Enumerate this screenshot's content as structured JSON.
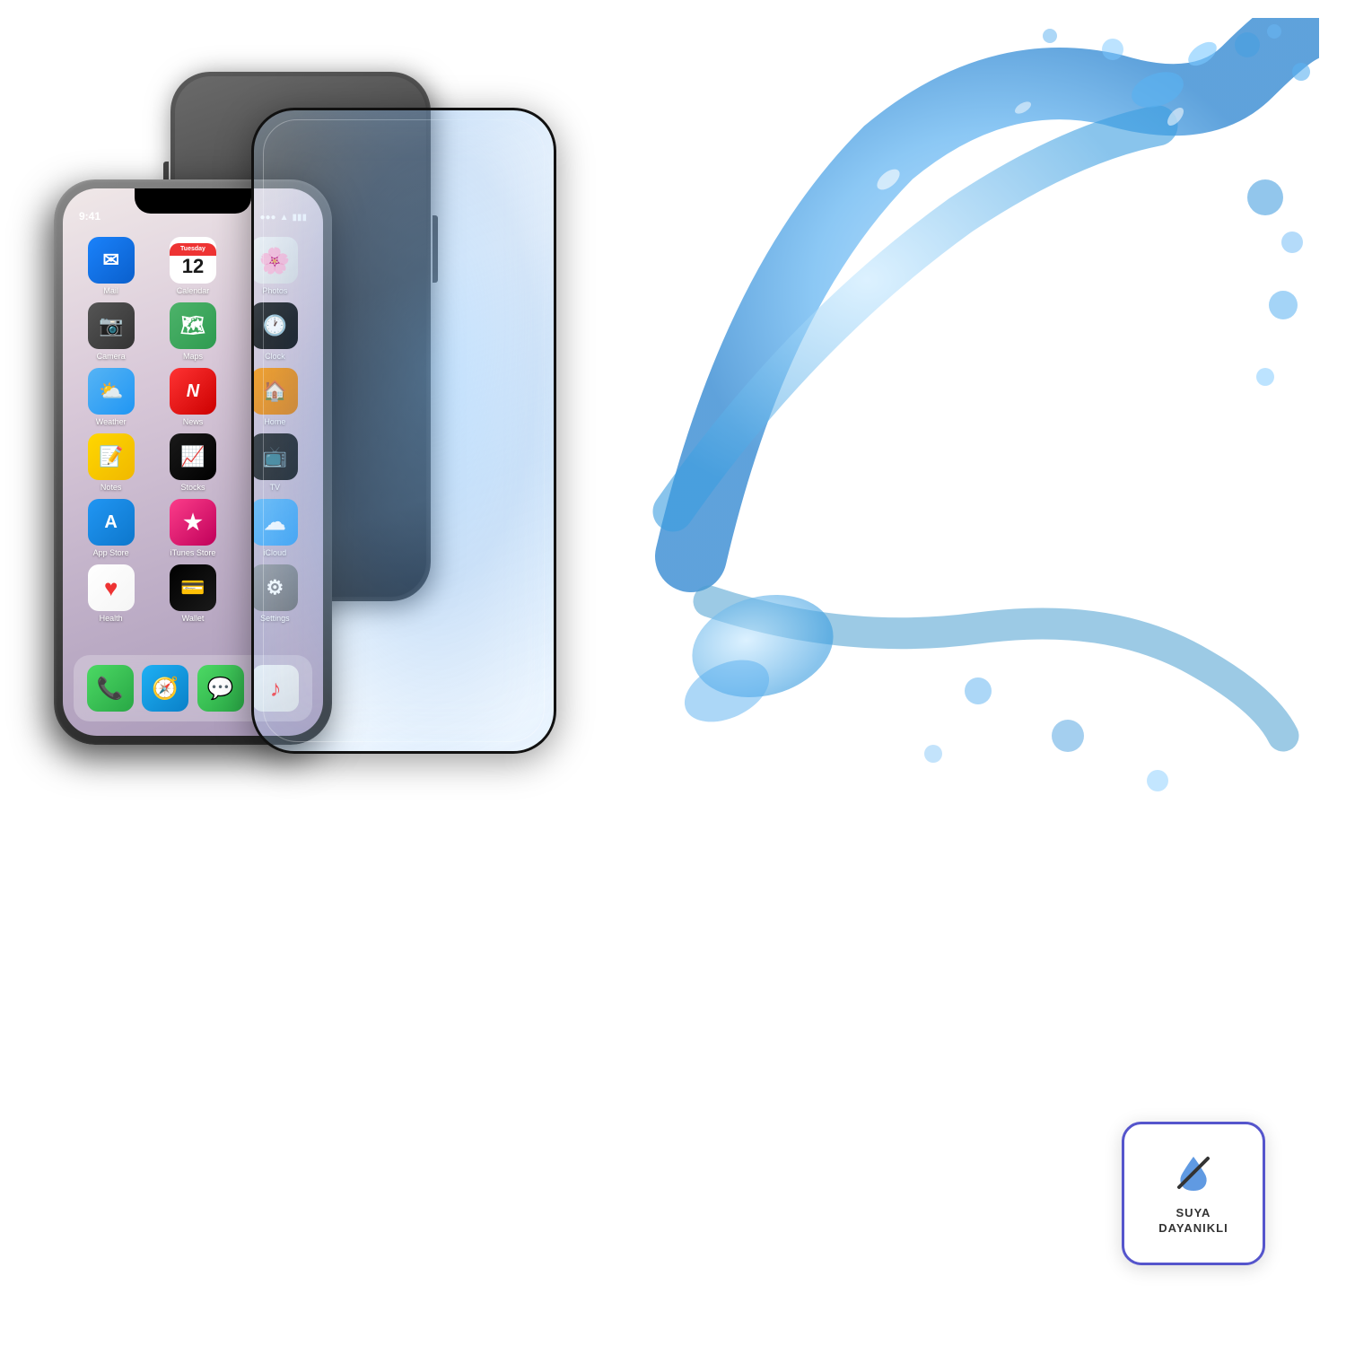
{
  "scene": {
    "bg_color": "#ffffff"
  },
  "iphone_back": {
    "label": "iPhone back view"
  },
  "iphone_front": {
    "label": "iPhone front view",
    "status": {
      "time": "9:41",
      "signal": "●●●●",
      "wifi": "▲",
      "battery": "▮▮▮"
    },
    "apps": [
      {
        "id": "mail",
        "label": "Mail",
        "icon": "✉",
        "class": "icon-mail"
      },
      {
        "id": "calendar",
        "label": "Calendar",
        "icon": "",
        "class": "icon-cal"
      },
      {
        "id": "photos",
        "label": "Photos",
        "icon": "🌸",
        "class": "icon-photos"
      },
      {
        "id": "camera",
        "label": "Camera",
        "icon": "📷",
        "class": "icon-camera"
      },
      {
        "id": "maps",
        "label": "Maps",
        "icon": "🗺",
        "class": "icon-maps"
      },
      {
        "id": "clock",
        "label": "Clock",
        "icon": "🕐",
        "class": "icon-clock"
      },
      {
        "id": "weather",
        "label": "Weather",
        "icon": "⛅",
        "class": "icon-weather"
      },
      {
        "id": "news",
        "label": "News",
        "icon": "N",
        "class": "icon-news"
      },
      {
        "id": "home",
        "label": "Home",
        "icon": "🏠",
        "class": "icon-home"
      },
      {
        "id": "notes",
        "label": "Notes",
        "icon": "📝",
        "class": "icon-notes"
      },
      {
        "id": "stocks",
        "label": "Stocks",
        "icon": "📈",
        "class": "icon-stocks"
      },
      {
        "id": "tv",
        "label": "TV",
        "icon": "📺",
        "class": "icon-tv"
      },
      {
        "id": "appstore",
        "label": "App Store",
        "icon": "A",
        "class": "icon-appstore"
      },
      {
        "id": "itunes",
        "label": "iTunes Store",
        "icon": "★",
        "class": "icon-itunes"
      },
      {
        "id": "icloud",
        "label": "iCloud",
        "icon": "☁",
        "class": "icon-weather"
      },
      {
        "id": "health",
        "label": "Health",
        "icon": "♥",
        "class": "icon-health"
      },
      {
        "id": "wallet",
        "label": "Wallet",
        "icon": "💳",
        "class": "icon-wallet"
      },
      {
        "id": "settings",
        "label": "Settings",
        "icon": "⚙",
        "class": "icon-settings"
      }
    ],
    "dock": [
      {
        "id": "phone",
        "label": "Phone",
        "icon": "📞",
        "class": "icon-phone"
      },
      {
        "id": "safari",
        "label": "Safari",
        "icon": "🧭",
        "class": "icon-safari"
      },
      {
        "id": "messages",
        "label": "Messages",
        "icon": "💬",
        "class": "icon-messages"
      },
      {
        "id": "music",
        "label": "Music",
        "icon": "♪",
        "class": "icon-music"
      }
    ]
  },
  "glass_protector": {
    "label": "Tempered glass screen protector"
  },
  "waterproof_badge": {
    "label": "Water resistant badge",
    "line1": "SUYA",
    "line2": "DAYANIKLI"
  }
}
